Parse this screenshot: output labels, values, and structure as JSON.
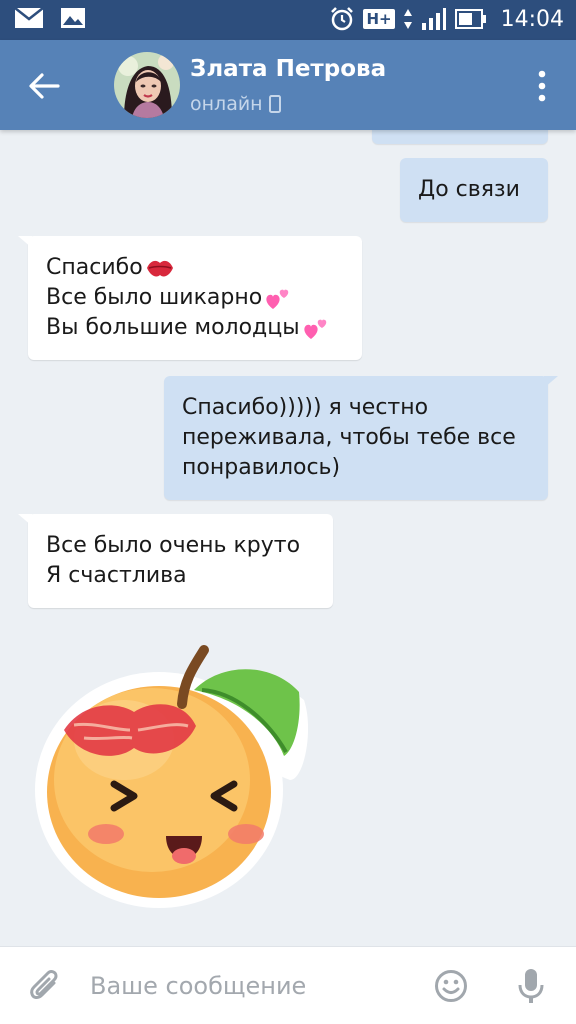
{
  "status_bar": {
    "time": "14:04",
    "network": "H+"
  },
  "header": {
    "name": "Злата Петрова",
    "status": "онлайн"
  },
  "messages": [
    {
      "side": "out",
      "lines": []
    },
    {
      "side": "out",
      "lines": [
        "До связи"
      ]
    },
    {
      "side": "in",
      "lines": [
        "Спасибо",
        "Все было шикарно",
        "Вы большие молодцы"
      ]
    },
    {
      "side": "out",
      "lines": [
        "Спасибо))))) я честно",
        "переживала, чтобы тебе все",
        "понравилось)"
      ]
    },
    {
      "side": "in",
      "lines": [
        "Все было очень круто",
        "Я счастлива"
      ]
    },
    {
      "side": "in",
      "type": "sticker",
      "sticker": "peach-kiss-sticker"
    }
  ],
  "input": {
    "placeholder": "Ваше сообщение"
  },
  "colors": {
    "header": "#5682b7",
    "status_bar": "#2d4e7d",
    "background": "#ecf0f4",
    "bubble_out": "#cfe0f3",
    "bubble_in": "#ffffff"
  }
}
